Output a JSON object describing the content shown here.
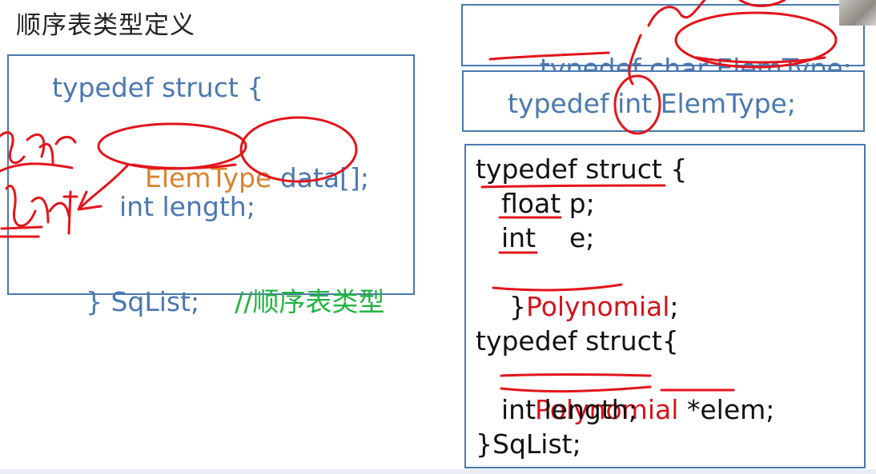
{
  "slide": {
    "title": "顺序表类型定义",
    "left_code": {
      "line1": "typedef struct {",
      "line2_type": "ElemType",
      "line2_rest": " data[];",
      "line3": "int length;",
      "line4_code": "} SqList;",
      "line4_comment": "//顺序表类型"
    },
    "top_right": {
      "line_a_prefix": "typedef char ",
      "line_a_name": "ElemType;",
      "line_b": "typedef int ElemType;"
    },
    "right_code": {
      "l1": "typedef struct {",
      "l2": "float p;",
      "l3": "int    e;",
      "l4_open": "}",
      "l4_name": "Polynomial",
      "l4_end": ";",
      "l6": "typedef struct{",
      "l7_type": "Polynomial",
      "l7_rest": " *elem;",
      "l8": "int length;",
      "l9": "}SqList;"
    },
    "annotations": {
      "handwritten_top": "char",
      "handwritten_bottom": "int"
    }
  },
  "colors": {
    "border": "#4a78b0",
    "code_blue": "#4a78b0",
    "type_orange": "#d9822b",
    "comment_green": "#1fb33f",
    "ink_red": "#e3141b"
  }
}
